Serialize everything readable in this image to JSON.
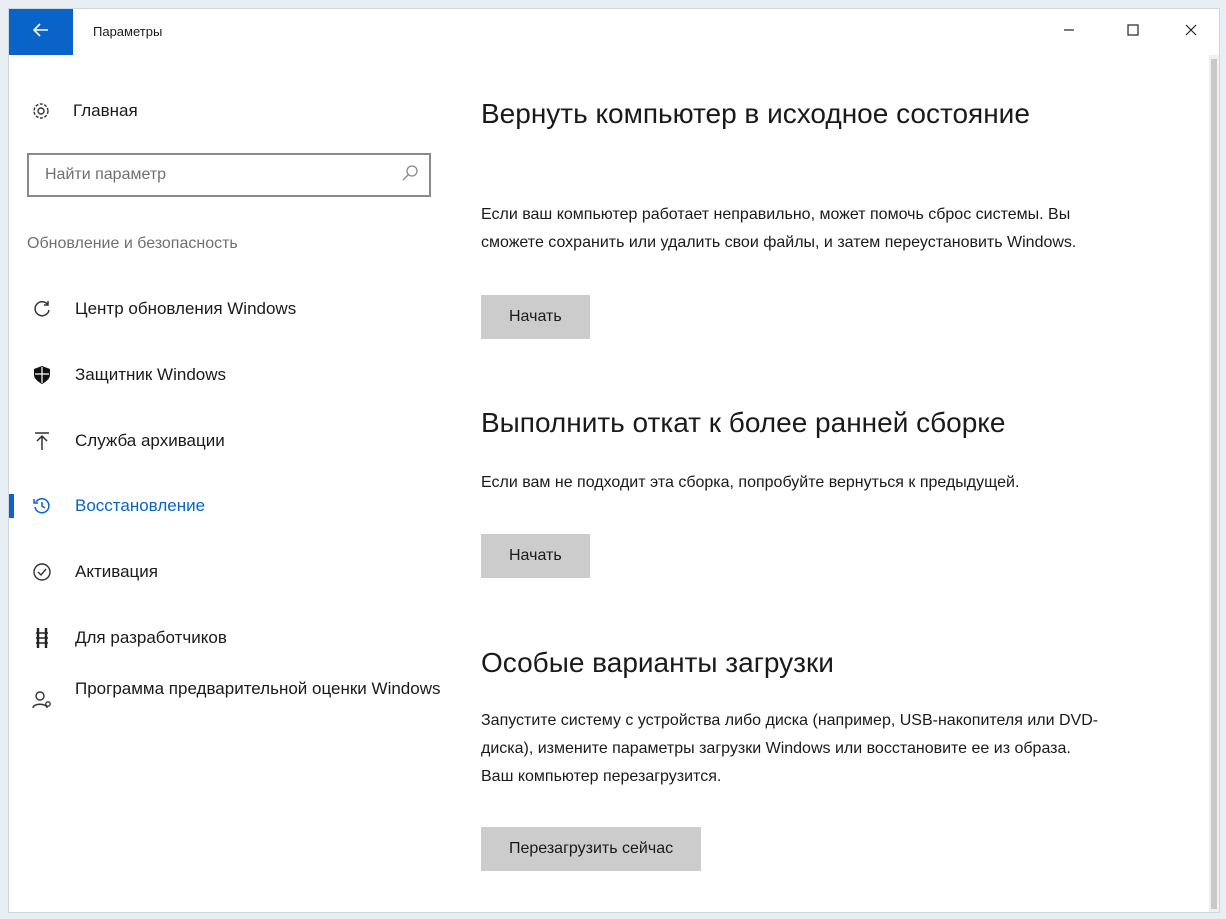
{
  "window": {
    "title": "Параметры",
    "controls": {
      "minimize": "–",
      "maximize": "□",
      "close": "✕"
    }
  },
  "sidebar": {
    "home_label": "Главная",
    "search_placeholder": "Найти параметр",
    "section_label": "Обновление и безопасность",
    "items": [
      {
        "label": "Центр обновления Windows",
        "icon": "refresh-icon",
        "active": false
      },
      {
        "label": "Защитник Windows",
        "icon": "shield-icon",
        "active": false
      },
      {
        "label": "Служба архивации",
        "icon": "upload-arrow-icon",
        "active": false
      },
      {
        "label": "Восстановление",
        "icon": "history-icon",
        "active": true
      },
      {
        "label": "Активация",
        "icon": "check-circle-icon",
        "active": false
      },
      {
        "label": "Для разработчиков",
        "icon": "developer-icon",
        "active": false
      },
      {
        "label": "Программа предварительной оценки Windows",
        "icon": "insider-icon",
        "active": false
      }
    ]
  },
  "main": {
    "sections": [
      {
        "heading": "Вернуть компьютер в исходное состояние",
        "text": "Если ваш компьютер работает неправильно, может помочь сброс системы. Вы сможете сохранить или удалить свои файлы, и затем переустановить Windows.",
        "button": "Начать"
      },
      {
        "heading": "Выполнить откат к более ранней сборке",
        "text": "Если вам не подходит эта сборка, попробуйте вернуться к предыдущей.",
        "button": "Начать"
      },
      {
        "heading": "Особые варианты загрузки",
        "text": "Запустите систему с устройства либо диска (например, USB-накопителя или DVD-диска), измените параметры загрузки Windows или восстановите ее из образа. Ваш компьютер перезагрузится.",
        "button": "Перезагрузить сейчас"
      }
    ]
  },
  "colors": {
    "accent": "#0a63c9",
    "button_bg": "#cccccc",
    "muted_text": "#707070"
  }
}
